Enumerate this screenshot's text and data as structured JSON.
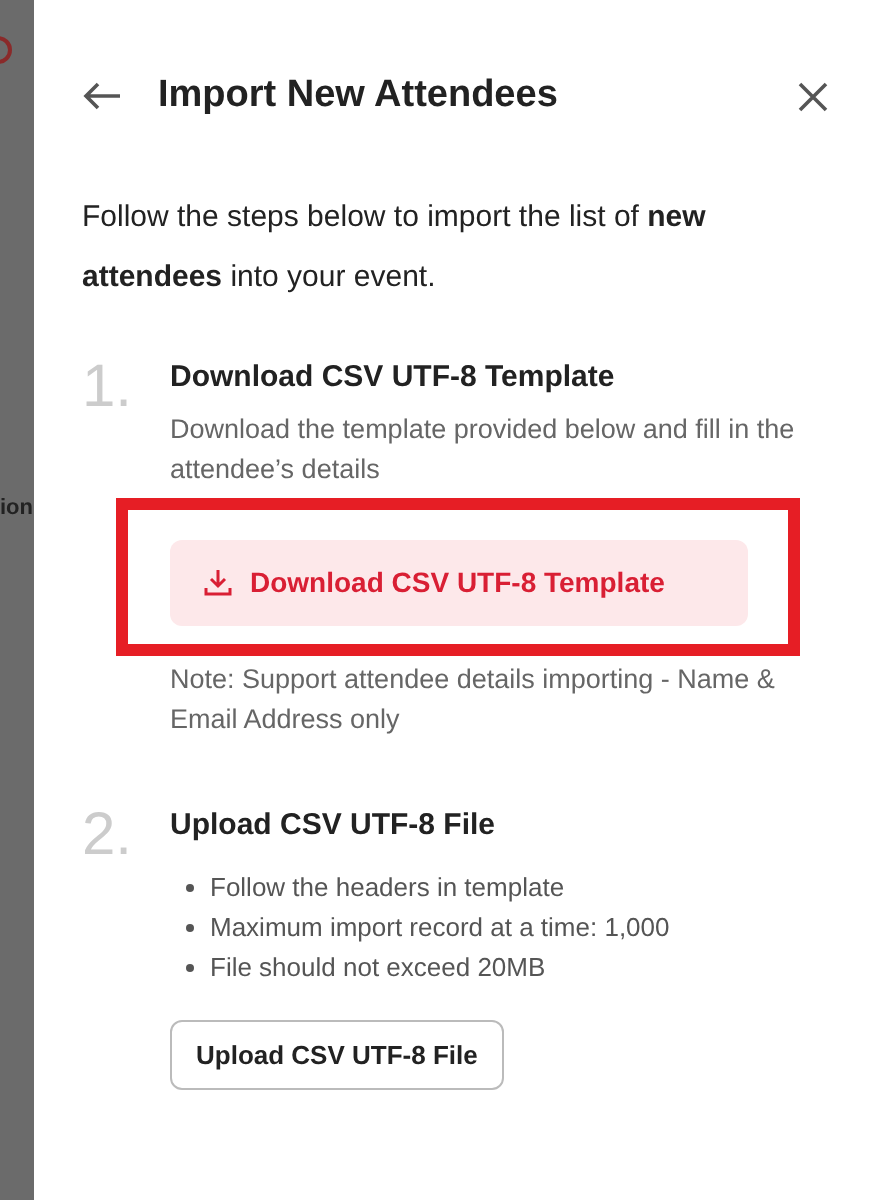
{
  "backdrop": {
    "cut_text": "ion"
  },
  "dialog": {
    "title": "Import New Attendees",
    "intro": "Follow the steps below to import the list of **new attendees** into your event.",
    "steps": [
      {
        "number": "1.",
        "title": "Download CSV UTF-8 Template",
        "description": "Download the template provided below and fill in the attendee’s details",
        "button": {
          "label": "Download CSV UTF-8 Template",
          "kind": "primary"
        },
        "note": "Note: Support attendee details importing - Name & Email Address only"
      },
      {
        "number": "2.",
        "title": "Upload CSV UTF-8 File",
        "bullets": [
          "Follow the headers in template",
          "Maximum import record at a time: 1,000",
          "File should not exceed 20MB"
        ],
        "button": {
          "label": "Upload CSV UTF-8 File",
          "kind": "outline"
        }
      }
    ]
  }
}
